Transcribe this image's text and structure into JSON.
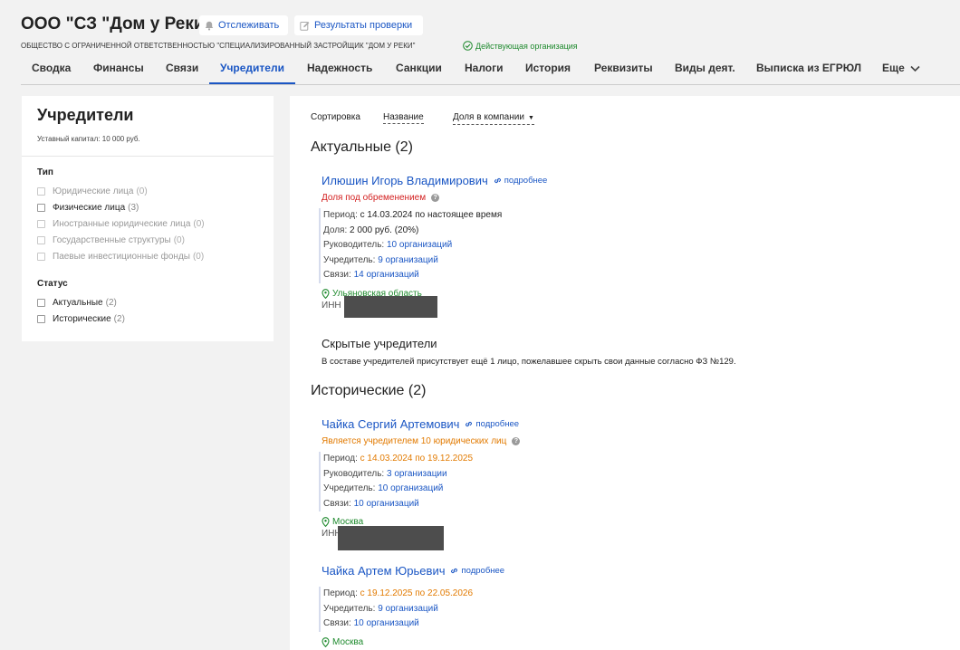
{
  "header": {
    "title": "ООО \"СЗ \"Дом у Реки\"",
    "track_label": "Отслеживать",
    "check_label": "Результаты проверки",
    "full_name": "ОБЩЕСТВО С ОГРАНИЧЕННОЙ ОТВЕТСТВЕННОСТЬЮ \"СПЕЦИАЛИЗИРОВАННЫЙ ЗАСТРОЙЩИК \"ДОМ У РЕКИ\"",
    "status": "Действующая организация",
    "status_color": "#1f8a2e"
  },
  "tabs": [
    {
      "label": "Сводка"
    },
    {
      "label": "Финансы"
    },
    {
      "label": "Связи"
    },
    {
      "label": "Учредители",
      "active": true
    },
    {
      "label": "Надежность"
    },
    {
      "label": "Санкции"
    },
    {
      "label": "Налоги"
    },
    {
      "label": "История"
    },
    {
      "label": "Реквизиты"
    },
    {
      "label": "Виды деят."
    },
    {
      "label": "Выписка из ЕГРЮЛ"
    },
    {
      "label": "Еще"
    }
  ],
  "sidebar": {
    "title": "Учредители",
    "capital": "Уставный капитал: 10 000 руб.",
    "type_title": "Тип",
    "types": [
      {
        "label": "Юридические лица",
        "count": "(0)"
      },
      {
        "label": "Физические лица",
        "count": "(3)"
      },
      {
        "label": "Иностранные юридические лица",
        "count": "(0)"
      },
      {
        "label": "Государственные структуры",
        "count": "(0)"
      },
      {
        "label": "Паевые инвестиционные фонды",
        "count": "(0)"
      }
    ],
    "status_title": "Статус",
    "statuses": [
      {
        "label": "Актуальные",
        "count": "(2)"
      },
      {
        "label": "Исторические",
        "count": "(2)"
      }
    ]
  },
  "sort": {
    "label": "Сортировка",
    "by_name": "Название",
    "by_share": "Доля в компании"
  },
  "actual": {
    "title": "Актуальные (2)",
    "person": {
      "name": "Илюшин Игорь Владимирович",
      "more": "подробнее",
      "note": "Доля под обременением",
      "period_label": "Период:",
      "period": "с 14.03.2024 по настоящее время",
      "share_label": "Доля:",
      "share": "2 000 руб. (20%)",
      "head_label": "Руководитель:",
      "head": "10 организаций",
      "founder_label": "Учредитель:",
      "founder": "9 организаций",
      "links_label": "Связи:",
      "links": "14 организаций",
      "location": "Ульяновская область",
      "inn_label": "ИНН"
    },
    "hidden_title": "Скрытые учредители",
    "hidden_text": "В составе учредителей присутствует ещё 1 лицо, пожелавшее скрыть свои данные согласно ФЗ №129."
  },
  "historical": {
    "title": "Исторические (2)",
    "p1": {
      "name": "Чайка Сергий Артемович",
      "more": "подробнее",
      "note": "Является учредителем 10 юридических лиц",
      "period_label": "Период:",
      "period": "с 14.03.2024 по 19.12.2025",
      "head_label": "Руководитель:",
      "head": "3 организации",
      "founder_label": "Учредитель:",
      "founder": "10 организаций",
      "links_label": "Связи:",
      "links": "10 организаций",
      "location": "Москва",
      "inn_label": "ИНН"
    },
    "p2": {
      "name": "Чайка Артем Юрьевич",
      "more": "подробнее",
      "period_label": "Период:",
      "period": "с 19.12.2025 по 22.05.2026",
      "founder_label": "Учредитель:",
      "founder": "9 организаций",
      "links_label": "Связи:",
      "links": "10 организаций",
      "location": "Москва"
    }
  }
}
